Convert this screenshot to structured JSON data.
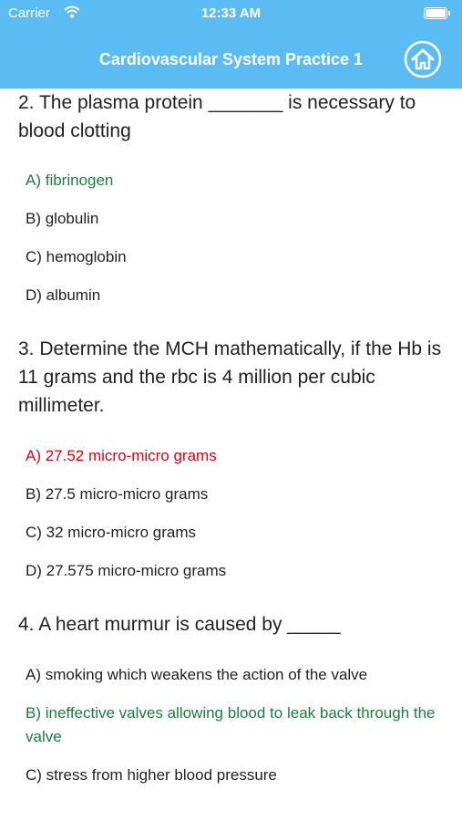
{
  "status_bar": {
    "carrier": "Carrier",
    "time": "12:33 AM",
    "wifi_icon": "wifi-icon",
    "battery_icon": "battery-icon"
  },
  "header": {
    "title": "Cardiovascular System Practice 1",
    "home_icon": "home-icon",
    "background_color": "#5bbcf3"
  },
  "colors": {
    "correct": "#1e7d3c",
    "wrong": "#e60012"
  },
  "questions": [
    {
      "text": "2. The plasma protein _______ is necessary to blood clotting",
      "options": [
        {
          "label": "A) fibrinogen",
          "state": "correct"
        },
        {
          "label": "B) globulin",
          "state": "normal"
        },
        {
          "label": "C) hemoglobin",
          "state": "normal"
        },
        {
          "label": "D) albumin",
          "state": "normal"
        }
      ]
    },
    {
      "text": "3. Determine the MCH mathematically, if the Hb is 11 grams and the rbc is 4 million per cubic millimeter.",
      "options": [
        {
          "label": "A) 27.52 micro-micro grams",
          "state": "wrong"
        },
        {
          "label": "B) 27.5 micro-micro grams",
          "state": "normal"
        },
        {
          "label": "C) 32 micro-micro grams",
          "state": "normal"
        },
        {
          "label": "D) 27.575 micro-micro grams",
          "state": "normal"
        }
      ]
    },
    {
      "text": "4. A heart murmur is caused by _____",
      "options": [
        {
          "label": "A) smoking which weakens the action of the valve",
          "state": "normal"
        },
        {
          "label": "B) ineffective valves allowing blood to leak back through the valve",
          "state": "correct"
        },
        {
          "label": "C) stress from higher blood pressure",
          "state": "normal"
        }
      ]
    }
  ]
}
